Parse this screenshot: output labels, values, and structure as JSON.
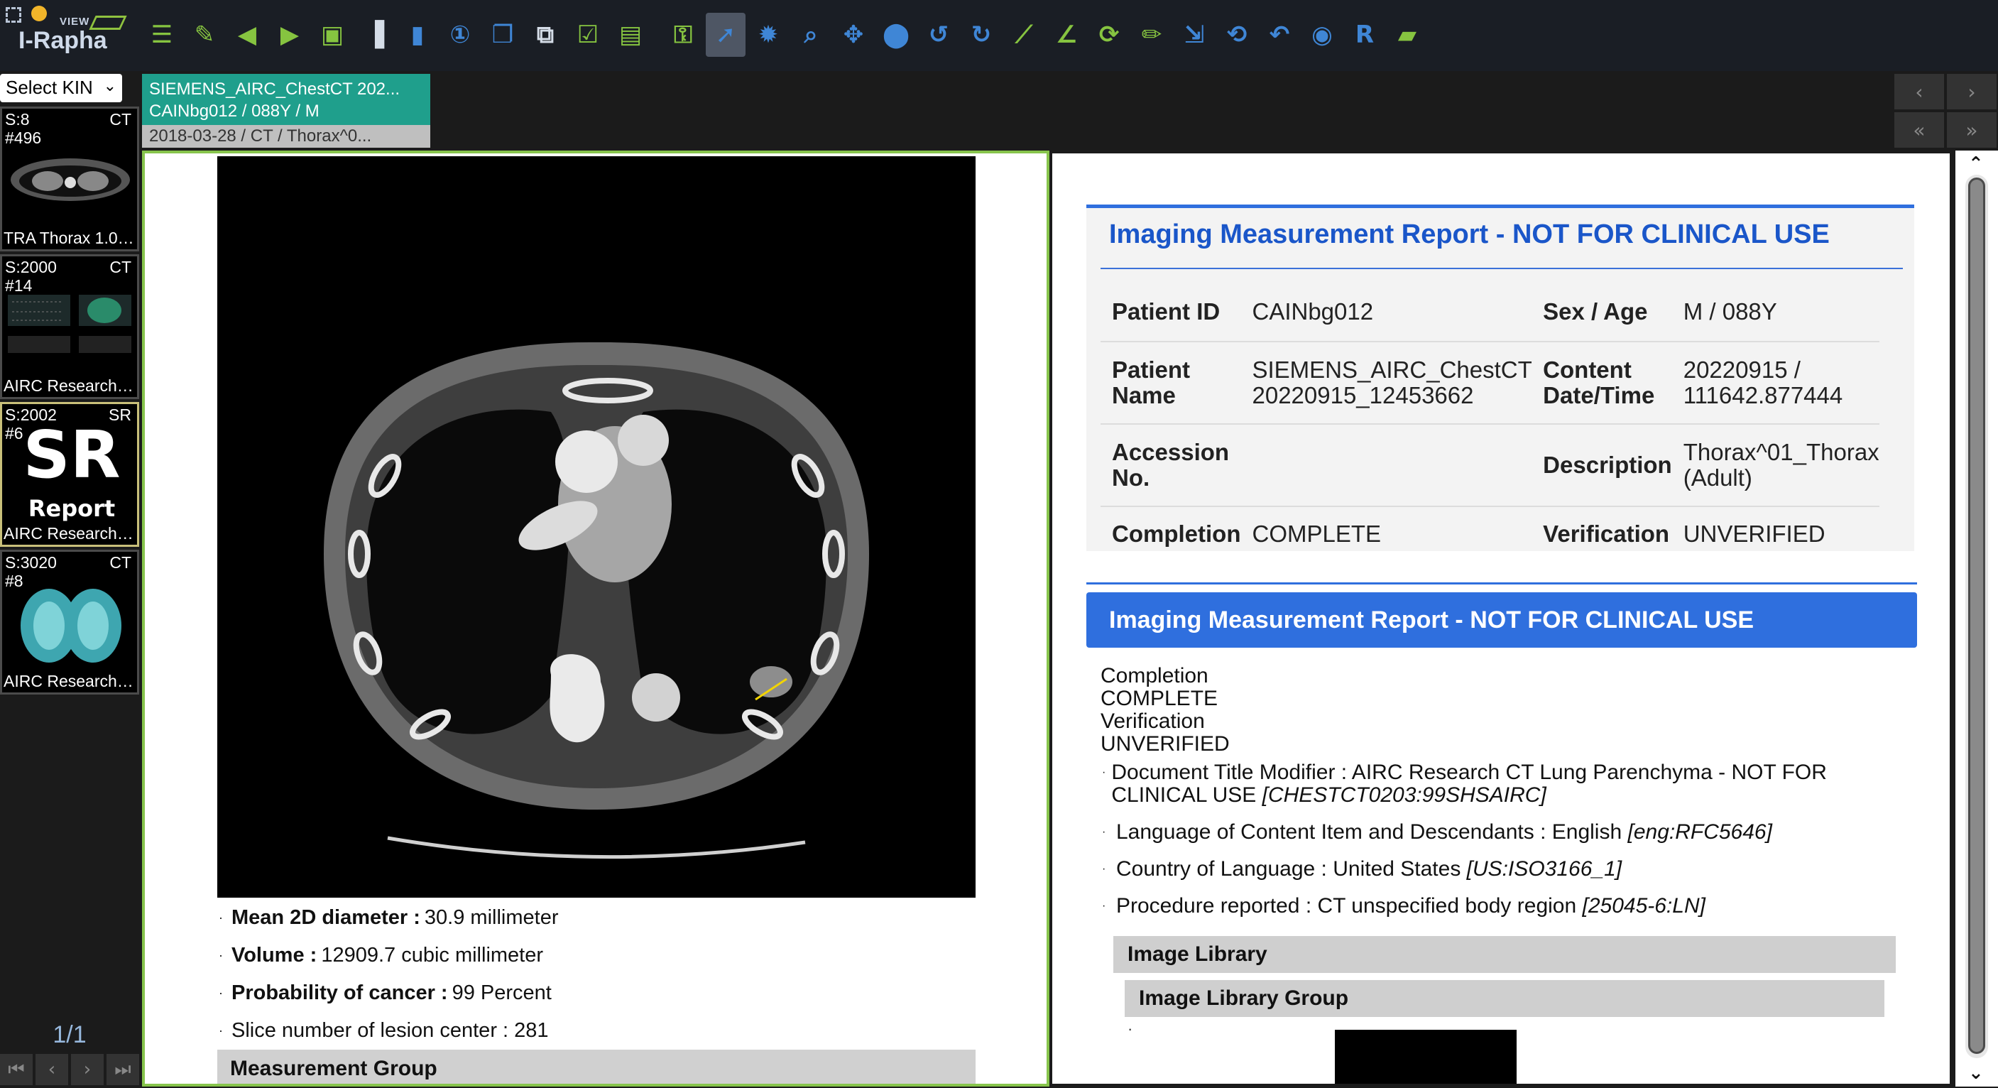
{
  "brand": {
    "view": "VIEW",
    "name": "I-Rapha"
  },
  "toolbar": {
    "icons": [
      "list-icon",
      "edit-icon",
      "prev-icon",
      "next-icon",
      "vl-icon",
      "split-icon",
      "layout-icon",
      "one-icon",
      "stack-icon",
      "window-icon",
      "check-icon",
      "annotation-icon",
      "key-icon",
      "pointer-icon",
      "window-level-icon",
      "zoom-icon",
      "pan-icon",
      "fit-icon",
      "rotate-left-icon",
      "rotate-right-icon",
      "ruler-icon",
      "angle-icon",
      "reset-icon",
      "measure-icon",
      "export-icon",
      "refresh-icon",
      "undo-icon",
      "camera-icon",
      "r-icon",
      "folder-icon"
    ]
  },
  "left": {
    "kin_select": "Select KIN",
    "thumbs": [
      {
        "series": "S:8",
        "count": "#496",
        "modality": "CT",
        "label": "TRA Thorax 1.0 I..."
      },
      {
        "series": "S:2000",
        "count": "#14",
        "modality": "CT",
        "label": "AIRC Research R..."
      },
      {
        "series": "S:2002",
        "count": "#6",
        "modality": "SR",
        "big": "SR",
        "sub": "Report",
        "label": "AIRC Research S..."
      },
      {
        "series": "S:3020",
        "count": "#8",
        "modality": "CT",
        "label": "AIRC Research P..."
      }
    ],
    "pager": "1/1"
  },
  "tab": {
    "line1": "SIEMENS_AIRC_ChestCT 202...",
    "line2": "CAINbg012 / 088Y / M",
    "line3": "2018-03-28 / CT / Thorax^0..."
  },
  "measurements": [
    {
      "label": "Mean 2D diameter :",
      "value": "30.9 millimeter",
      "bold": true
    },
    {
      "label": "Volume :",
      "value": "12909.7 cubic millimeter",
      "bold": true
    },
    {
      "label": "Probability of cancer :",
      "value": "99 Percent",
      "bold": true
    },
    {
      "label": "",
      "value": "Slice number of lesion center : 281",
      "bold": false
    }
  ],
  "measurement_group": "Measurement Group",
  "report": {
    "title": "Imaging Measurement Report - NOT FOR CLINICAL USE",
    "rows": [
      {
        "k1": "Patient ID",
        "v1": "CAINbg012",
        "k2": "Sex / Age",
        "v2": "M / 088Y"
      },
      {
        "k1": "Patient Name",
        "v1": "SIEMENS_AIRC_ChestCT 20220915_12453662",
        "k2": "Content Date/Time",
        "v2": "20220915 / 111642.877444"
      },
      {
        "k1": "Accession No.",
        "v1": "",
        "k2": "Description",
        "v2": "Thorax^01_Thorax (Adult)"
      },
      {
        "k1": "Completion",
        "v1": "COMPLETE",
        "k2": "Verification",
        "v2": "UNVERIFIED"
      }
    ],
    "section_title": "Imaging Measurement Report - NOT FOR CLINICAL USE",
    "pairs": [
      "Completion",
      "COMPLETE",
      "Verification",
      "UNVERIFIED"
    ],
    "items": [
      {
        "text": "Document Title Modifier : AIRC Research CT Lung Parenchyma - NOT FOR CLINICAL USE ",
        "code": "[CHESTCT0203:99SHSAIRC]"
      },
      {
        "text": "Language of Content Item and Descendants : English ",
        "code": "[eng:RFC5646]"
      },
      {
        "text": "Country of Language : United States ",
        "code": "[US:ISO3166_1]"
      },
      {
        "text": "Procedure reported : CT unspecified body region ",
        "code": "[25045-6:LN]"
      }
    ],
    "image_library": "Image Library",
    "image_library_group": "Image Library Group",
    "tiny_dot": "·"
  }
}
